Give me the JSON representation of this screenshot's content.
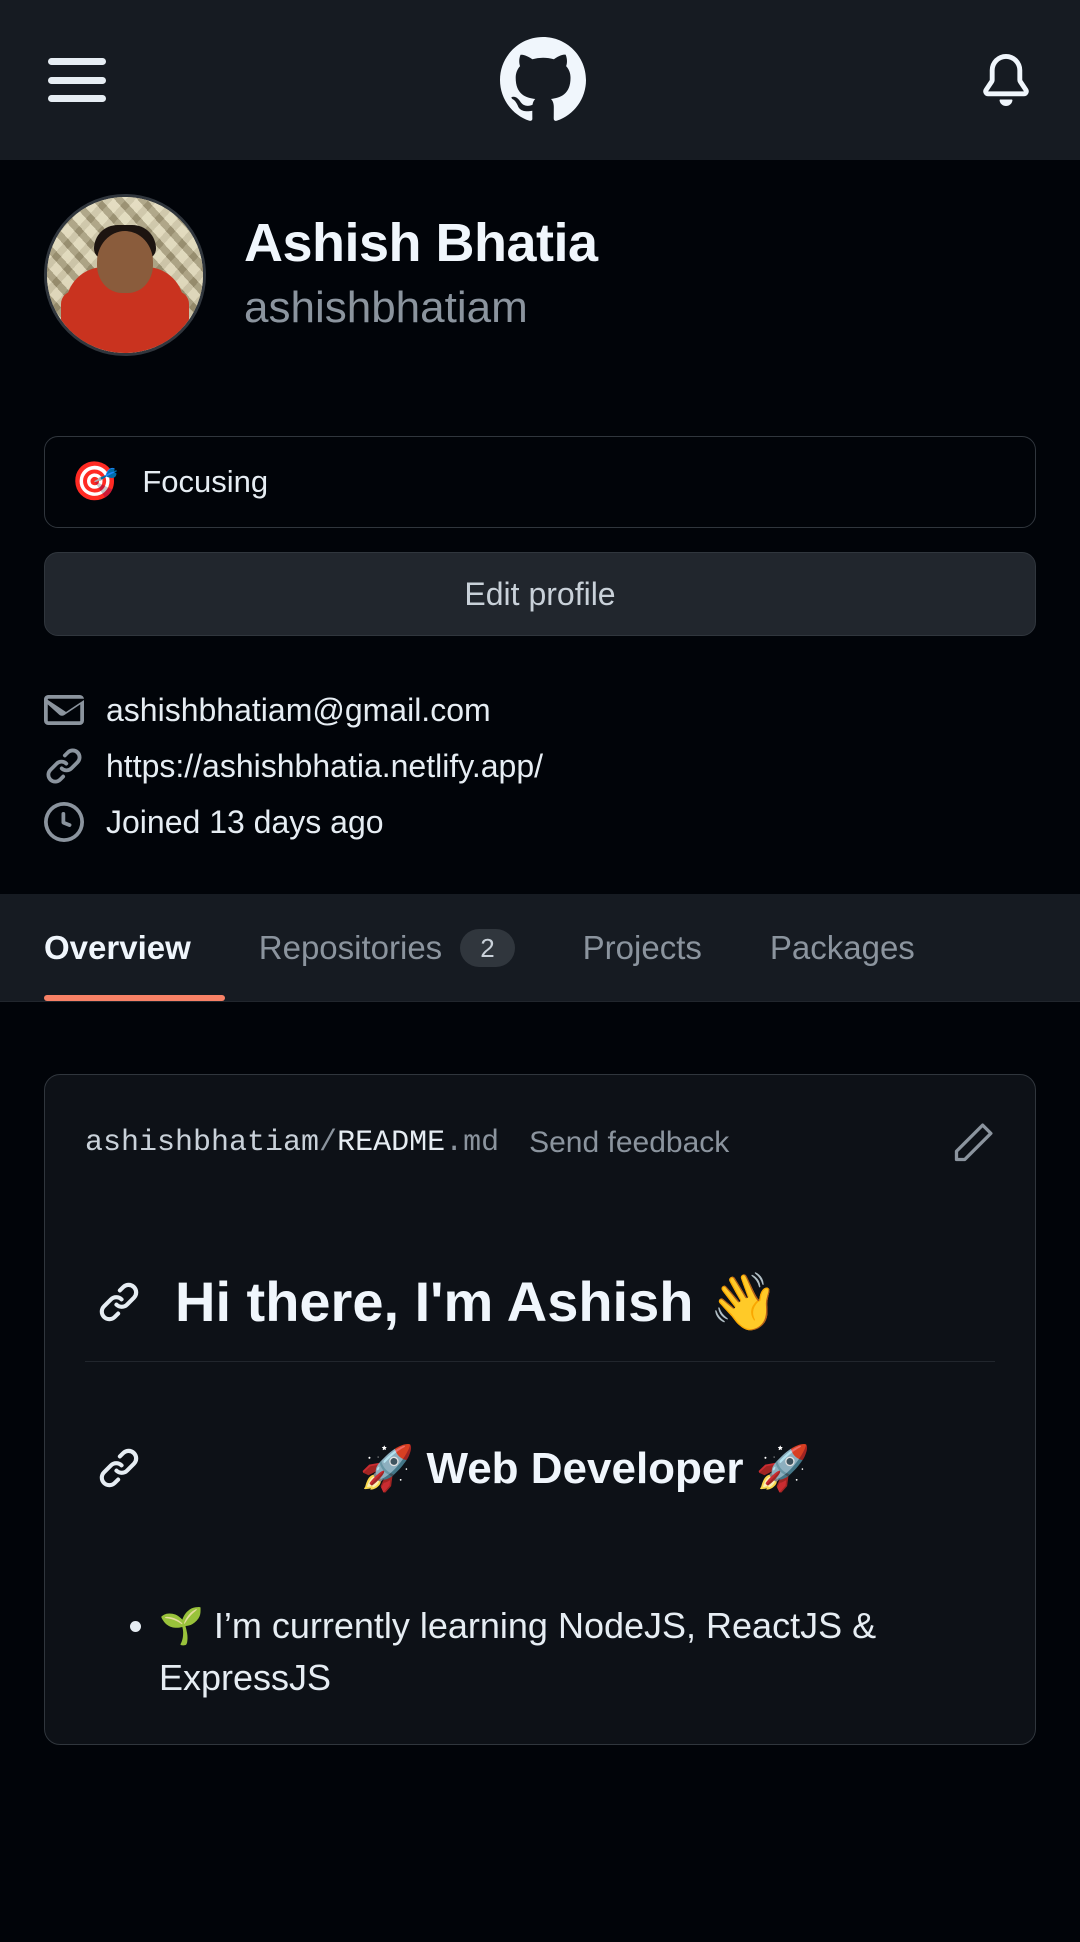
{
  "appbar": {
    "menu_icon": "hamburger-menu-icon",
    "logo_icon": "github-octocat-logo",
    "notifications_icon": "bell-icon"
  },
  "profile": {
    "avatar_alt": "Ashish Bhatia avatar",
    "full_name": "Ashish Bhatia",
    "username": "ashishbhatiam",
    "status": {
      "emoji": "🎯",
      "text": "Focusing"
    },
    "edit_button": "Edit profile",
    "meta": [
      {
        "icon": "mail-icon",
        "text": "ashishbhatiam@gmail.com"
      },
      {
        "icon": "link-icon",
        "text": "https://ashishbhatia.netlify.app/"
      },
      {
        "icon": "clock-icon",
        "text": "Joined 13 days ago"
      }
    ]
  },
  "tabs": [
    {
      "label": "Overview",
      "badge": "",
      "active": true
    },
    {
      "label": "Repositories",
      "badge": "2",
      "active": false
    },
    {
      "label": "Projects",
      "badge": "",
      "active": false
    },
    {
      "label": "Packages",
      "badge": "",
      "active": false
    }
  ],
  "readme": {
    "owner": "ashishbhatiam",
    "separator": "/",
    "file": "README",
    "extension": ".md",
    "feedback_label": "Send feedback",
    "edit_icon": "pencil-icon",
    "heading1": "Hi there, I'm Ashish 👋",
    "heading2": "🚀 Web Developer 🚀",
    "bullets": [
      "🌱 I’m currently learning NodeJS, ReactJS & ExpressJS"
    ]
  },
  "colors": {
    "page_bg": "#010409",
    "appbar_bg": "#161b22",
    "card_bg": "#0d1117",
    "border": "#30363d",
    "text_primary": "#e6edf3",
    "text_muted": "#8b949e",
    "accent_underline": "#f78166",
    "button_bg": "#21262d"
  }
}
